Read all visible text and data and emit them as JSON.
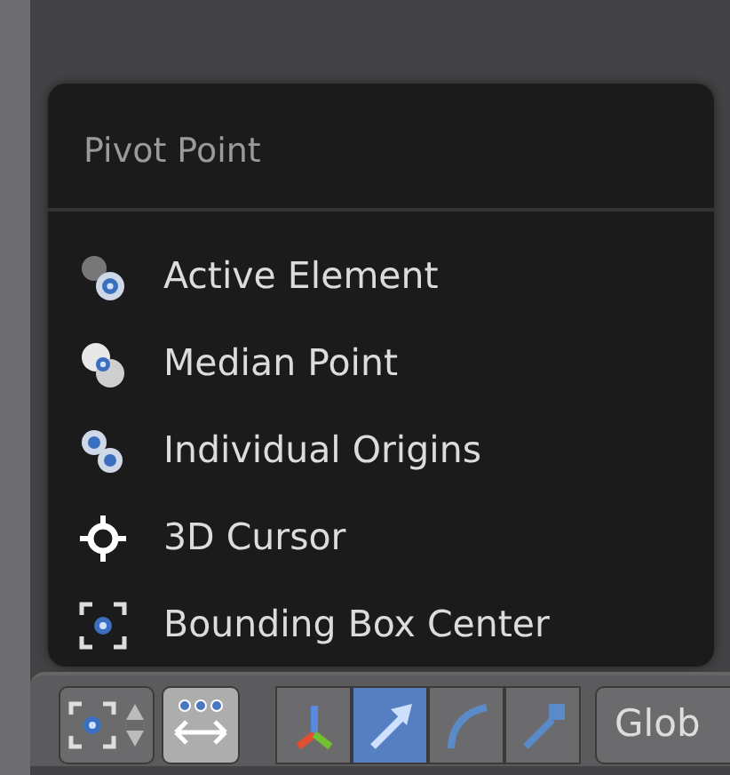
{
  "menu": {
    "title": "Pivot Point",
    "items": [
      {
        "kind": "active",
        "label": "Active Element"
      },
      {
        "kind": "median",
        "label": "Median Point"
      },
      {
        "kind": "individual",
        "label": "Individual Origins"
      },
      {
        "kind": "cursor",
        "label": "3D Cursor"
      },
      {
        "kind": "bbox",
        "label": "Bounding Box Center"
      }
    ]
  },
  "toolbar": {
    "pivot": {
      "kind": "bbox"
    },
    "manipulator_toggle": {
      "on": true
    },
    "tools": [
      {
        "kind": "axes",
        "selected": false
      },
      {
        "kind": "translate",
        "selected": true
      },
      {
        "kind": "rotate",
        "selected": false
      },
      {
        "kind": "scale",
        "selected": false
      }
    ],
    "orientation": {
      "value": "Glob"
    }
  }
}
